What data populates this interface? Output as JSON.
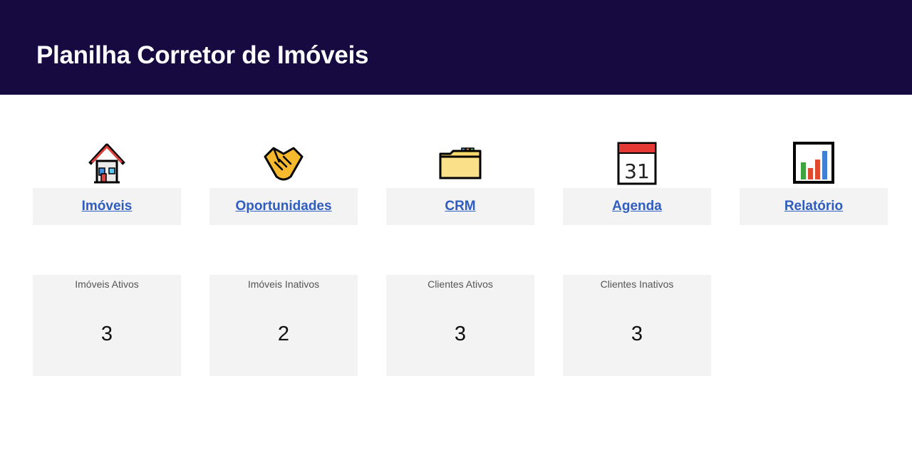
{
  "header": {
    "title": "Planilha Corretor de Imóveis"
  },
  "nav": [
    {
      "label": "Imóveis",
      "icon": "house-icon"
    },
    {
      "label": "Oportunidades",
      "icon": "handshake-icon"
    },
    {
      "label": "CRM",
      "icon": "folder-icon"
    },
    {
      "label": "Agenda",
      "icon": "calendar-icon",
      "icon_text": "31"
    },
    {
      "label": "Relatório",
      "icon": "bar-chart-icon"
    }
  ],
  "stats": [
    {
      "label": "Imóveis Ativos",
      "value": "3"
    },
    {
      "label": "Imóveis Inativos",
      "value": "2"
    },
    {
      "label": "Clientes Ativos",
      "value": "3"
    },
    {
      "label": "Clientes Inativos",
      "value": "3"
    }
  ],
  "colors": {
    "header_bg": "#170a40",
    "link": "#2f5dbf",
    "card_bg": "#f3f3f3"
  }
}
